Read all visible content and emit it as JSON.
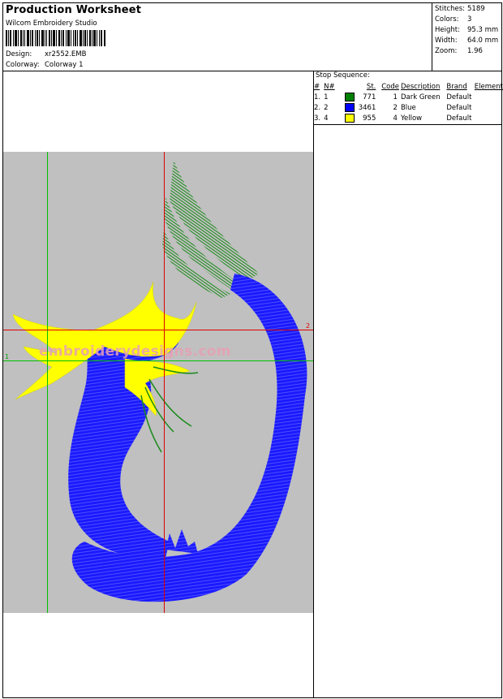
{
  "header": {
    "title": "Production Worksheet",
    "software": "Wilcom Embroidery Studio",
    "design_label": "Design:",
    "design_value": "xr2552.EMB",
    "colorway_label": "Colorway:",
    "colorway_value": "Colorway 1"
  },
  "stats": {
    "stitches_label": "Stitches:",
    "stitches_value": "5189",
    "colors_label": "Colors:",
    "colors_value": "3",
    "height_label": "Height:",
    "height_value": "95.3 mm",
    "width_label": "Width:",
    "width_value": "64.0 mm",
    "zoom_label": "Zoom:",
    "zoom_value": "1.96"
  },
  "stop_sequence": {
    "title": "Stop Sequence:",
    "headers": [
      "#",
      "N#",
      "St.",
      "Code",
      "Description",
      "Brand",
      "Element"
    ],
    "rows": [
      {
        "num": "1.",
        "n": "1",
        "color": "#008000",
        "st": "771",
        "code": "1",
        "desc": "Dark Green",
        "brand": "Default"
      },
      {
        "num": "2.",
        "n": "2",
        "color": "#0000ff",
        "st": "3461",
        "code": "2",
        "desc": "Blue",
        "brand": "Default"
      },
      {
        "num": "3.",
        "n": "4",
        "color": "#ffff00",
        "st": "955",
        "code": "4",
        "desc": "Yellow",
        "brand": "Default"
      }
    ]
  },
  "canvas": {
    "watermark": "embroiderydesigns.com",
    "axis_label_1": "1",
    "axis_label_2": "2"
  }
}
